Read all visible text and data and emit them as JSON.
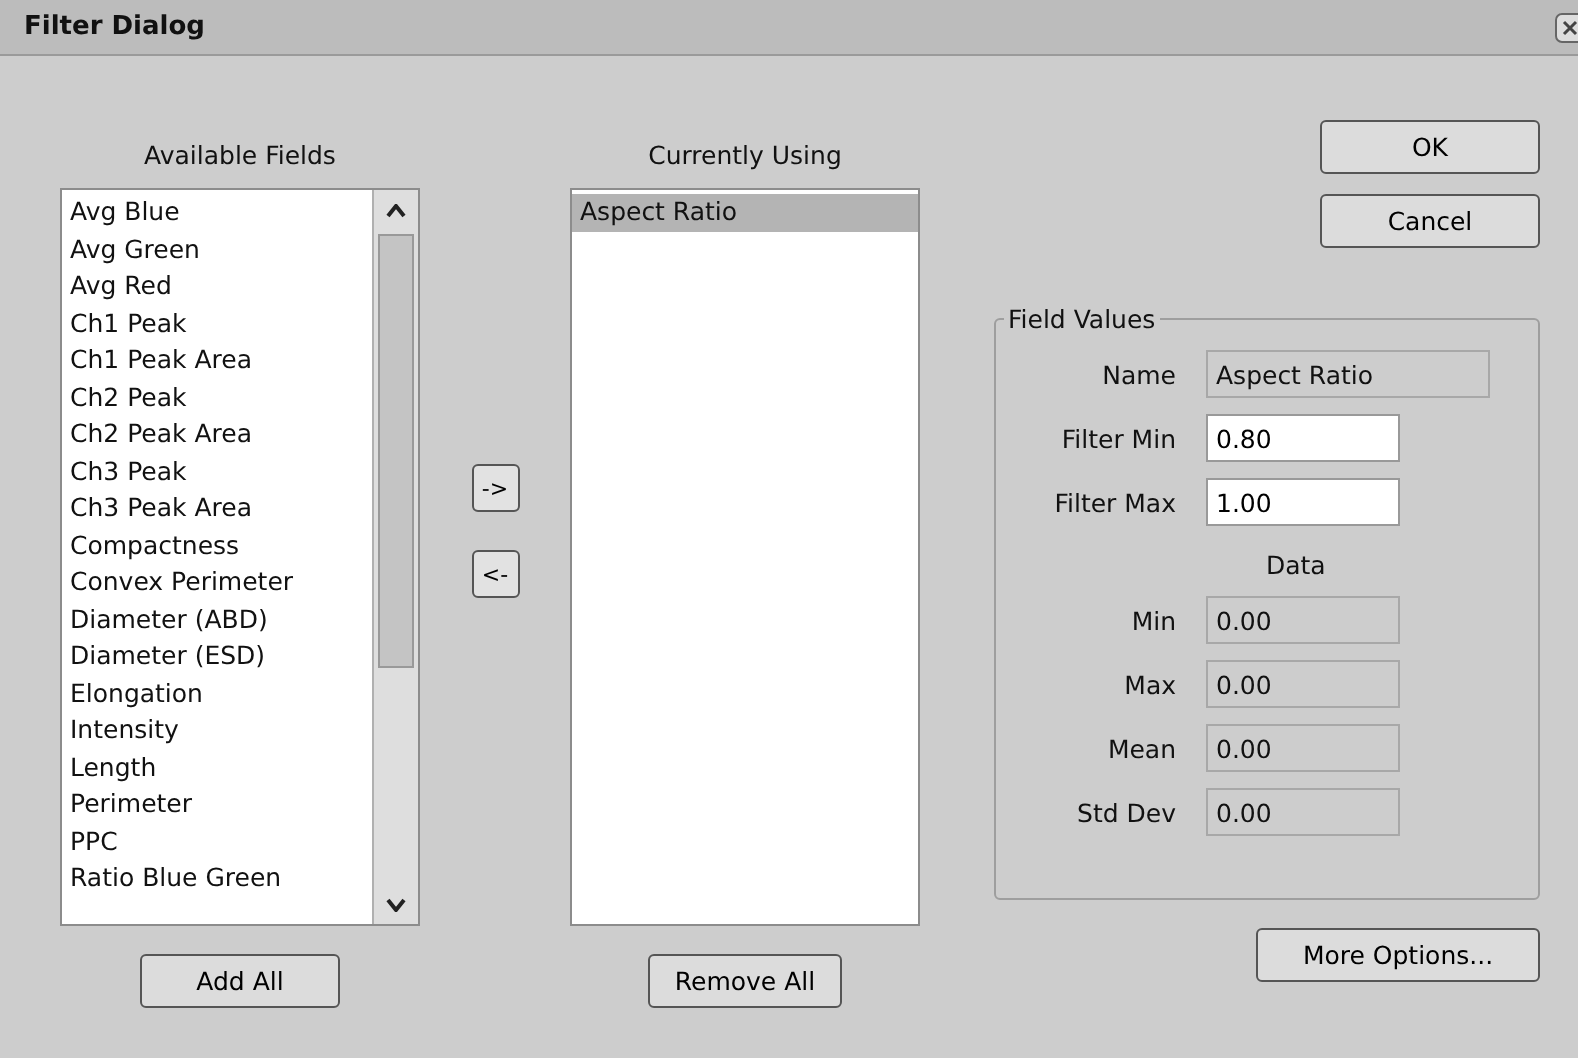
{
  "window": {
    "title": "Filter Dialog"
  },
  "available_fields": {
    "label": "Available Fields",
    "items": [
      {
        "label": "Avg Blue",
        "selected": false
      },
      {
        "label": "Avg Green",
        "selected": false
      },
      {
        "label": "Avg Red",
        "selected": false
      },
      {
        "label": "Ch1 Peak",
        "selected": false
      },
      {
        "label": "Ch1 Peak Area",
        "selected": false
      },
      {
        "label": "Ch2 Peak",
        "selected": false
      },
      {
        "label": "Ch2 Peak Area",
        "selected": false
      },
      {
        "label": "Ch3 Peak",
        "selected": false
      },
      {
        "label": "Ch3 Peak Area",
        "selected": false
      },
      {
        "label": "Compactness",
        "selected": false
      },
      {
        "label": "Convex Perimeter",
        "selected": false
      },
      {
        "label": "Diameter (ABD)",
        "selected": false
      },
      {
        "label": "Diameter (ESD)",
        "selected": false
      },
      {
        "label": "Elongation",
        "selected": false
      },
      {
        "label": "Intensity",
        "selected": false
      },
      {
        "label": "Length",
        "selected": false
      },
      {
        "label": "Perimeter",
        "selected": false
      },
      {
        "label": "PPC",
        "selected": false
      },
      {
        "label": "Ratio Blue Green",
        "selected": false
      }
    ],
    "button": "Add All"
  },
  "move_buttons": [
    "->",
    "<-"
  ],
  "currently_using": {
    "label": "Currently Using",
    "items": [
      {
        "label": "Aspect Ratio",
        "selected": true
      }
    ],
    "button": "Remove All"
  },
  "dialog_buttons": [
    "OK",
    "Cancel"
  ],
  "field_values": {
    "title": "Field Values",
    "name": {
      "label": "Name",
      "value": "Aspect Ratio"
    },
    "filters": [
      {
        "label": "Filter Min",
        "value": "0.80"
      },
      {
        "label": "Filter Max",
        "value": "1.00"
      }
    ],
    "data_title": "Data",
    "data": [
      {
        "label": "Min",
        "value": "0.00"
      },
      {
        "label": "Max",
        "value": "0.00"
      },
      {
        "label": "Mean",
        "value": "0.00"
      },
      {
        "label": "Std Dev",
        "value": "0.00"
      }
    ]
  },
  "more_options": "More Options..."
}
